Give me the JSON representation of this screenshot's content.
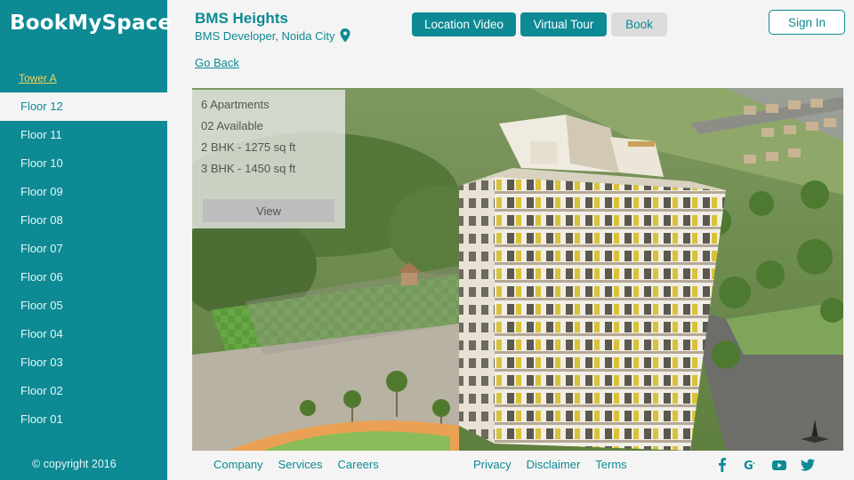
{
  "brand": "BookMySpace",
  "sidebar": {
    "tower_label": "Tower A",
    "floors": [
      "Floor 12",
      "Floor 11",
      "Floor 10",
      "Floor 09",
      "Floor 08",
      "Floor 07",
      "Floor 06",
      "Floor 05",
      "Floor 04",
      "Floor 03",
      "Floor 02",
      "Floor 01"
    ],
    "active_floor": "Floor 12",
    "copyright": "© copyright 2016"
  },
  "project": {
    "title": "BMS Heights",
    "developer": "BMS Developer, Noida City"
  },
  "header": {
    "location_video": "Location Video",
    "virtual_tour": "Virtual Tour",
    "book": "Book",
    "sign_in": "Sign In",
    "go_back": "Go Back"
  },
  "info": {
    "apartments": "6 Apartments",
    "available": "02 Available",
    "bhk2": "2 BHK - 1275 sq ft",
    "bhk3": "3 BHK - 1450 sq ft",
    "view": "View"
  },
  "footer": {
    "left": [
      "Company",
      "Services",
      "Careers"
    ],
    "right": [
      "Privacy",
      "Disclaimer",
      "Terms"
    ]
  },
  "colors": {
    "brand": "#0d8a94",
    "tower_link": "#f0d35a",
    "page_bg": "#f4f4f4"
  }
}
